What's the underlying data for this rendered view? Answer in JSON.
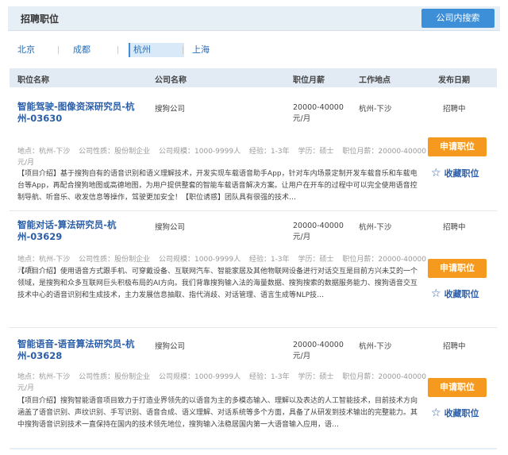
{
  "page": {
    "title": "招聘职位",
    "search_button": "公司内搜索"
  },
  "cities": [
    {
      "label": "北京",
      "selected": false
    },
    {
      "label": "成都",
      "selected": false
    },
    {
      "label": "杭州",
      "selected": true
    },
    {
      "label": "上海",
      "selected": false
    }
  ],
  "columns": {
    "name": "职位名称",
    "company": "公司名称",
    "salary": "职位月薪",
    "location": "工作地点",
    "date": "发布日期"
  },
  "actions": {
    "apply": "申请职位",
    "favorite": "收藏职位"
  },
  "colors": {
    "accent": "#3d8fd8",
    "apply": "#f59a1f",
    "link": "#2a5ea8"
  },
  "jobs": [
    {
      "title": "智能驾驶-图像资深研究员-杭州-03630",
      "company": "搜狗公司",
      "salary": "20000-40000元/月",
      "location": "杭州-下沙",
      "status": "招聘中",
      "meta": {
        "location": "地点：杭州-下沙",
        "nature": "公司性质：股份制企业",
        "size": "公司规模：1000-9999人",
        "experience": "经验：1-3年",
        "education": "学历：硕士",
        "salary": "职位月薪：20000-40000元/月"
      },
      "desc": "【项目介绍】基于搜狗自有的语音识别和语义理解技术，开发实现车载语音助手App，针对车内场景定制开发车载音乐和车载电台等App，再配合搜狗地图或高德地图，为用户提供整套的智能车载语音解决方案。让用户在开车的过程中可以完全使用语音控制导航、听音乐、收发信息等操作，驾驶更加安全！【职位诱惑】团队具有很强的技术…"
    },
    {
      "title": "智能对话-算法研究员-杭州-03629",
      "company": "搜狗公司",
      "salary": "20000-40000元/月",
      "location": "杭州-下沙",
      "status": "招聘中",
      "meta": {
        "location": "地点：杭州-下沙",
        "nature": "公司性质：股份制企业",
        "size": "公司规模：1000-9999人",
        "experience": "经验：1-3年",
        "education": "学历：硕士",
        "salary": "职位月薪：20000-40000元/月"
      },
      "desc": "【项目介绍】使用语音方式跟手机、可穿戴设备、互联网汽车、智能家居及其他物联网设备进行对话交互是目前方兴未艾的一个领域，是搜狗和众多互联网巨头积极布局的AI方向。我们背靠搜狗输入法的海量数据、搜狗搜索的数据服务能力、搜狗语音交互技术中心的语音识别和生成技术，主力发展信息抽取、指代消歧、对话管理、语言生成等NLP技…"
    },
    {
      "title": "智能语音-语音算法研究员-杭州-03628",
      "company": "搜狗公司",
      "salary": "20000-40000元/月",
      "location": "杭州-下沙",
      "status": "招聘中",
      "meta": {
        "location": "地点：杭州-下沙",
        "nature": "公司性质：股份制企业",
        "size": "公司规模：1000-9999人",
        "experience": "经验：1-3年",
        "education": "学历：硕士",
        "salary": "职位月薪：20000-40000元/月"
      },
      "desc": "【项目介绍】搜狗智能语音项目致力于打造业界领先的以语音为主的多模态输入、理解以及表达的人工智能技术，目前技术方向涵盖了语音识别、声纹识别、手写识别、语音合成、语义理解、对话系统等多个方面，具备了从研发到技术输出的完整能力。其中搜狗语音识别技术一直保持在国内的技术领先地位，搜狗输入法稳居国内第一大语音输入应用，语…"
    }
  ]
}
